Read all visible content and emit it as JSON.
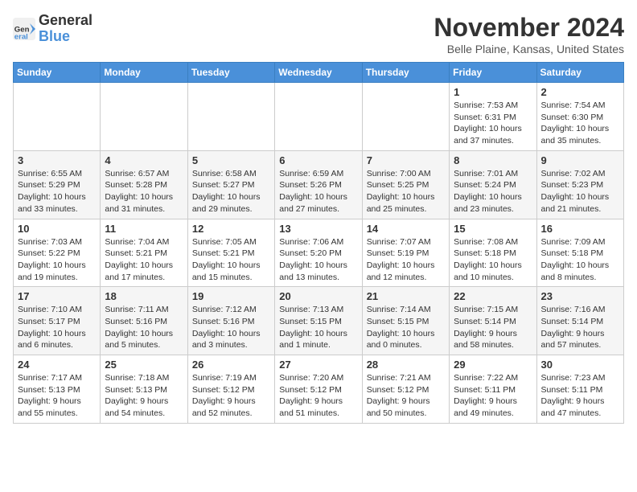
{
  "logo": {
    "text_general": "General",
    "text_blue": "Blue"
  },
  "header": {
    "month": "November 2024",
    "location": "Belle Plaine, Kansas, United States"
  },
  "weekdays": [
    "Sunday",
    "Monday",
    "Tuesday",
    "Wednesday",
    "Thursday",
    "Friday",
    "Saturday"
  ],
  "weeks": [
    [
      {
        "day": "",
        "info": ""
      },
      {
        "day": "",
        "info": ""
      },
      {
        "day": "",
        "info": ""
      },
      {
        "day": "",
        "info": ""
      },
      {
        "day": "",
        "info": ""
      },
      {
        "day": "1",
        "info": "Sunrise: 7:53 AM\nSunset: 6:31 PM\nDaylight: 10 hours and 37 minutes."
      },
      {
        "day": "2",
        "info": "Sunrise: 7:54 AM\nSunset: 6:30 PM\nDaylight: 10 hours and 35 minutes."
      }
    ],
    [
      {
        "day": "3",
        "info": "Sunrise: 6:55 AM\nSunset: 5:29 PM\nDaylight: 10 hours and 33 minutes."
      },
      {
        "day": "4",
        "info": "Sunrise: 6:57 AM\nSunset: 5:28 PM\nDaylight: 10 hours and 31 minutes."
      },
      {
        "day": "5",
        "info": "Sunrise: 6:58 AM\nSunset: 5:27 PM\nDaylight: 10 hours and 29 minutes."
      },
      {
        "day": "6",
        "info": "Sunrise: 6:59 AM\nSunset: 5:26 PM\nDaylight: 10 hours and 27 minutes."
      },
      {
        "day": "7",
        "info": "Sunrise: 7:00 AM\nSunset: 5:25 PM\nDaylight: 10 hours and 25 minutes."
      },
      {
        "day": "8",
        "info": "Sunrise: 7:01 AM\nSunset: 5:24 PM\nDaylight: 10 hours and 23 minutes."
      },
      {
        "day": "9",
        "info": "Sunrise: 7:02 AM\nSunset: 5:23 PM\nDaylight: 10 hours and 21 minutes."
      }
    ],
    [
      {
        "day": "10",
        "info": "Sunrise: 7:03 AM\nSunset: 5:22 PM\nDaylight: 10 hours and 19 minutes."
      },
      {
        "day": "11",
        "info": "Sunrise: 7:04 AM\nSunset: 5:21 PM\nDaylight: 10 hours and 17 minutes."
      },
      {
        "day": "12",
        "info": "Sunrise: 7:05 AM\nSunset: 5:21 PM\nDaylight: 10 hours and 15 minutes."
      },
      {
        "day": "13",
        "info": "Sunrise: 7:06 AM\nSunset: 5:20 PM\nDaylight: 10 hours and 13 minutes."
      },
      {
        "day": "14",
        "info": "Sunrise: 7:07 AM\nSunset: 5:19 PM\nDaylight: 10 hours and 12 minutes."
      },
      {
        "day": "15",
        "info": "Sunrise: 7:08 AM\nSunset: 5:18 PM\nDaylight: 10 hours and 10 minutes."
      },
      {
        "day": "16",
        "info": "Sunrise: 7:09 AM\nSunset: 5:18 PM\nDaylight: 10 hours and 8 minutes."
      }
    ],
    [
      {
        "day": "17",
        "info": "Sunrise: 7:10 AM\nSunset: 5:17 PM\nDaylight: 10 hours and 6 minutes."
      },
      {
        "day": "18",
        "info": "Sunrise: 7:11 AM\nSunset: 5:16 PM\nDaylight: 10 hours and 5 minutes."
      },
      {
        "day": "19",
        "info": "Sunrise: 7:12 AM\nSunset: 5:16 PM\nDaylight: 10 hours and 3 minutes."
      },
      {
        "day": "20",
        "info": "Sunrise: 7:13 AM\nSunset: 5:15 PM\nDaylight: 10 hours and 1 minute."
      },
      {
        "day": "21",
        "info": "Sunrise: 7:14 AM\nSunset: 5:15 PM\nDaylight: 10 hours and 0 minutes."
      },
      {
        "day": "22",
        "info": "Sunrise: 7:15 AM\nSunset: 5:14 PM\nDaylight: 9 hours and 58 minutes."
      },
      {
        "day": "23",
        "info": "Sunrise: 7:16 AM\nSunset: 5:14 PM\nDaylight: 9 hours and 57 minutes."
      }
    ],
    [
      {
        "day": "24",
        "info": "Sunrise: 7:17 AM\nSunset: 5:13 PM\nDaylight: 9 hours and 55 minutes."
      },
      {
        "day": "25",
        "info": "Sunrise: 7:18 AM\nSunset: 5:13 PM\nDaylight: 9 hours and 54 minutes."
      },
      {
        "day": "26",
        "info": "Sunrise: 7:19 AM\nSunset: 5:12 PM\nDaylight: 9 hours and 52 minutes."
      },
      {
        "day": "27",
        "info": "Sunrise: 7:20 AM\nSunset: 5:12 PM\nDaylight: 9 hours and 51 minutes."
      },
      {
        "day": "28",
        "info": "Sunrise: 7:21 AM\nSunset: 5:12 PM\nDaylight: 9 hours and 50 minutes."
      },
      {
        "day": "29",
        "info": "Sunrise: 7:22 AM\nSunset: 5:11 PM\nDaylight: 9 hours and 49 minutes."
      },
      {
        "day": "30",
        "info": "Sunrise: 7:23 AM\nSunset: 5:11 PM\nDaylight: 9 hours and 47 minutes."
      }
    ]
  ]
}
